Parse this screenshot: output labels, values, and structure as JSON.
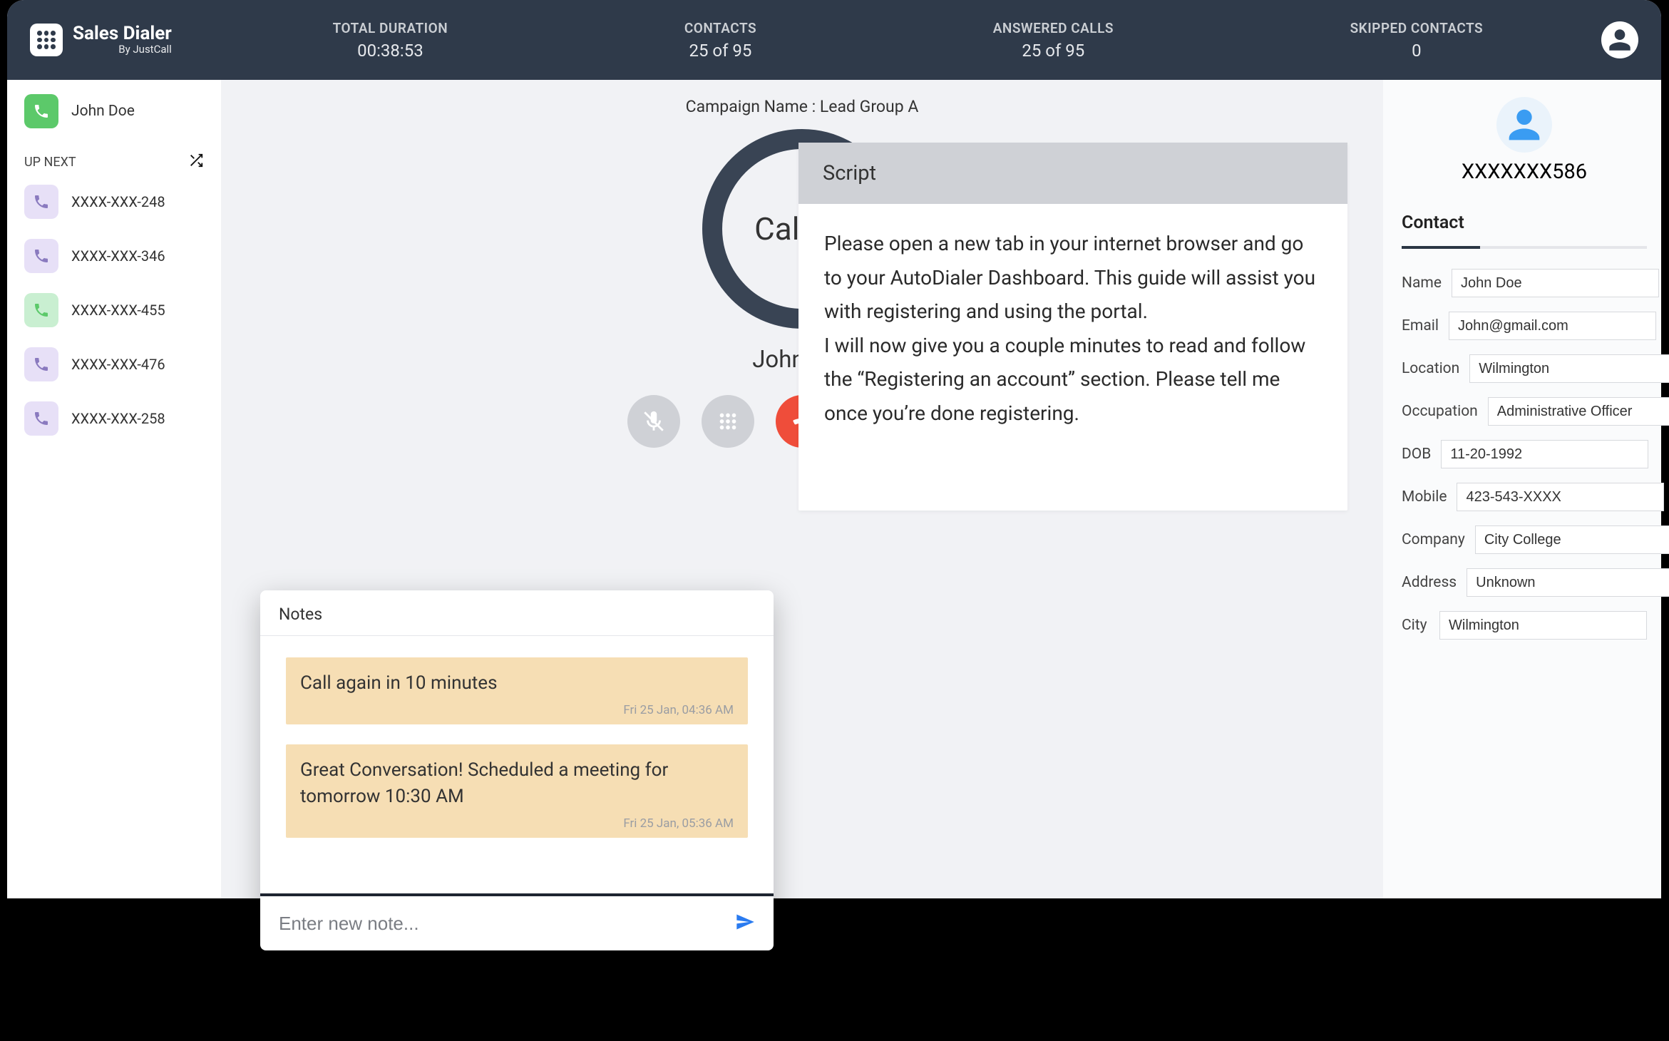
{
  "brand": {
    "title": "Sales Dialer",
    "sub": "By JustCall"
  },
  "stats": {
    "duration": {
      "label": "TOTAL DURATION",
      "value": "00:38:53"
    },
    "contacts": {
      "label": "CONTACTS",
      "value": "25 of 95"
    },
    "answered": {
      "label": "ANSWERED CALLS",
      "value": "25 of 95"
    },
    "skipped": {
      "label": "SKIPPED CONTACTS",
      "value": "0"
    }
  },
  "sidebar": {
    "current_name": "John Doe",
    "upnext_label": "UP NEXT",
    "queue": [
      {
        "num": "XXXX-XXX-248",
        "color": "purple"
      },
      {
        "num": "XXXX-XXX-346",
        "color": "purple"
      },
      {
        "num": "XXXX-XXX-455",
        "color": "green2"
      },
      {
        "num": "XXXX-XXX-476",
        "color": "purple"
      },
      {
        "num": "XXXX-XXX-258",
        "color": "purple"
      }
    ]
  },
  "center": {
    "campaign": "Campaign Name : Lead Group A",
    "ring_text": "Calling",
    "callee": "John Doe"
  },
  "script": {
    "heading": "Script",
    "body": "Please open a new tab in your internet browser and go to your AutoDialer Dashboard. This guide will assist you with registering and using the portal.\nI will now give you a couple minutes to read and follow the “Registering an account” section. Please tell me once you’re done registering."
  },
  "contact": {
    "id": "XXXXXXX586",
    "heading": "Contact",
    "fields": {
      "name": {
        "label": "Name",
        "value": "John Doe"
      },
      "email": {
        "label": "Email",
        "value": "John@gmail.com"
      },
      "location": {
        "label": "Location",
        "value": "Wilmington"
      },
      "occupation": {
        "label": "Occupation",
        "value": "Administrative Officer"
      },
      "dob": {
        "label": "DOB",
        "value": "11-20-1992"
      },
      "mobile": {
        "label": "Mobile",
        "value": "423-543-XXXX"
      },
      "company": {
        "label": "Company",
        "value": "City College"
      },
      "address": {
        "label": "Address",
        "value": "Unknown"
      },
      "city": {
        "label": "City",
        "value": "Wilmington"
      }
    }
  },
  "notes": {
    "heading": "Notes",
    "items": [
      {
        "text": "Call again in 10 minutes",
        "time": "Fri 25 Jan, 04:36 AM"
      },
      {
        "text": "Great Conversation! Scheduled a meeting for tomorrow 10:30 AM",
        "time": "Fri 25 Jan, 05:36 AM"
      }
    ],
    "input_placeholder": "Enter new note..."
  }
}
